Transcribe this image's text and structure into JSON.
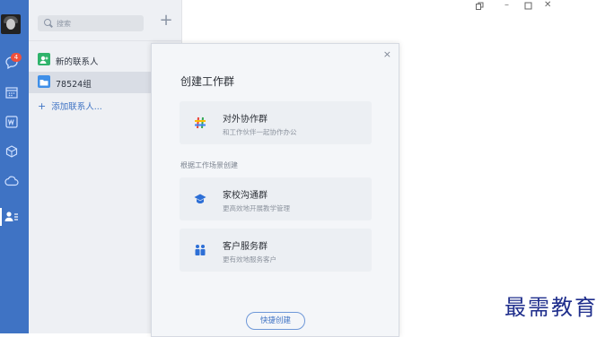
{
  "sidebar": {
    "badge_count": "4",
    "icons": [
      "chat-icon",
      "calendar-icon",
      "word-doc-icon",
      "cube-icon",
      "cloud-icon",
      "contacts-icon"
    ]
  },
  "contacts_panel": {
    "search_placeholder": "搜索",
    "items": [
      {
        "label": "新的联系人",
        "icon": "new-contact-icon",
        "color": "#2fb36b"
      },
      {
        "label": "78524组",
        "icon": "folder-icon",
        "color": "#3f8fe8"
      }
    ],
    "add_contact_label": "添加联系人..."
  },
  "window_controls": [
    "pin-icon",
    "minimize-icon",
    "maximize-icon",
    "close-icon"
  ],
  "modal": {
    "title": "创建工作群",
    "close_glyph": "×",
    "cards": [
      {
        "title": "对外协作群",
        "subtitle": "和工作伙伴一起协作办公",
        "icon": "hash-icon"
      },
      {
        "title": "家校沟通群",
        "subtitle": "更高效地开展教学管理",
        "icon": "graduation-cap-icon"
      },
      {
        "title": "客户服务群",
        "subtitle": "更有效地服务客户",
        "icon": "people-icon"
      }
    ],
    "section_label": "根据工作场景创建",
    "quick_create_label": "快捷创建"
  },
  "watermark": "最需教育",
  "colors": {
    "accent": "#3f73c4",
    "badge": "#f0503c"
  }
}
